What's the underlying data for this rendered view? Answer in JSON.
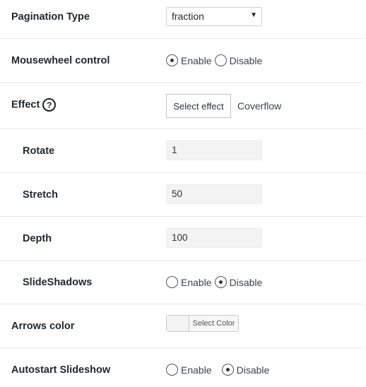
{
  "pagination": {
    "label": "Pagination Type",
    "selected": "fraction",
    "caret": "▼"
  },
  "mousewheel": {
    "label": "Mousewheel control",
    "options": [
      "Enable",
      "Disable"
    ],
    "selected": "Enable"
  },
  "effect": {
    "label": "Effect",
    "help": "?",
    "button_label": "Select effect",
    "value": "Coverflow"
  },
  "rotate": {
    "label": "Rotate",
    "value": "1"
  },
  "stretch": {
    "label": "Stretch",
    "value": "50"
  },
  "depth": {
    "label": "Depth",
    "value": "100"
  },
  "slideshadows": {
    "label": "SlideShadows",
    "options": [
      "Enable",
      "Disable"
    ],
    "selected": "Disable"
  },
  "arrows_color": {
    "label": "Arrows color",
    "button_label": "Select Color"
  },
  "autostart": {
    "label": "Autostart Slideshow",
    "options": [
      "Enable",
      "Disable"
    ],
    "selected": "Disable"
  }
}
